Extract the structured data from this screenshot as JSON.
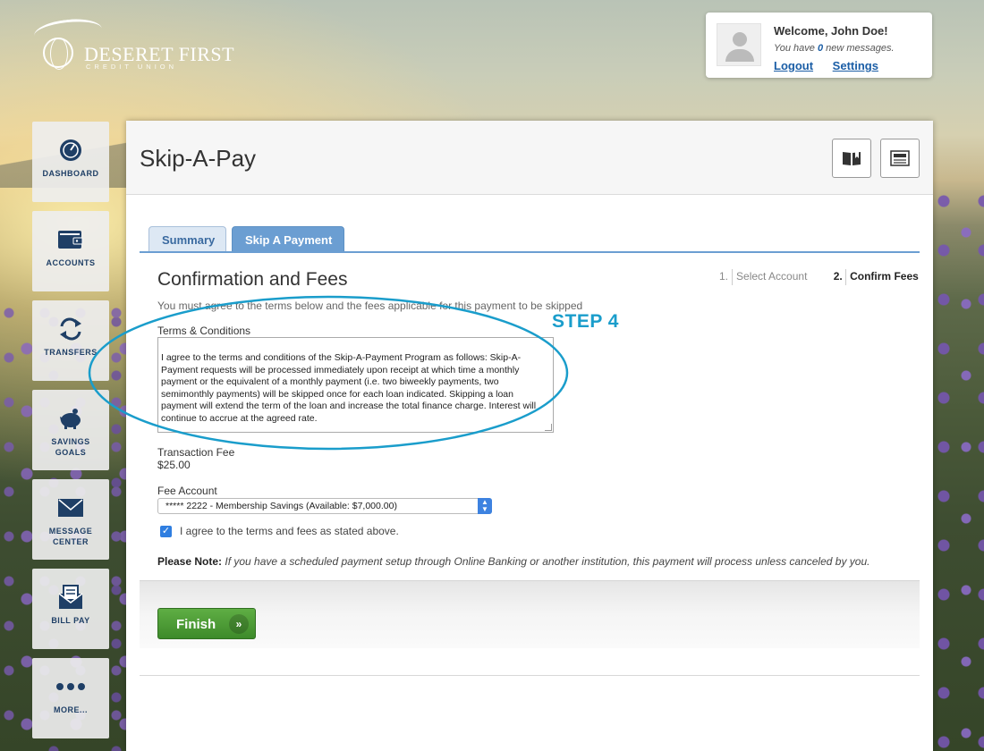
{
  "logo": {
    "name": "DESERET FIRST",
    "sub": "CREDIT UNION"
  },
  "welcome": {
    "title": "Welcome, John Doe!",
    "message_prefix": "You have",
    "message_count": "0",
    "message_suffix": "new messages.",
    "logout": "Logout",
    "settings": "Settings"
  },
  "nav": [
    {
      "label": "DASHBOARD",
      "icon": "dashboard-icon"
    },
    {
      "label": "ACCOUNTS",
      "icon": "wallet-icon"
    },
    {
      "label": "TRANSFERS",
      "icon": "transfer-icon"
    },
    {
      "label1": "SAVINGS",
      "label2": "GOALS",
      "icon": "piggy-bank-icon"
    },
    {
      "label1": "MESSAGE",
      "label2": "CENTER",
      "icon": "envelope-icon"
    },
    {
      "label": "BILL PAY",
      "icon": "bill-pay-icon"
    },
    {
      "label": "MORE...",
      "icon": "more-dots-icon"
    }
  ],
  "page": {
    "title": "Skip-A-Pay"
  },
  "tabs": {
    "summary": "Summary",
    "skip": "Skip A Payment"
  },
  "steps": {
    "step1_num": "1.",
    "step1_label": "Select Account",
    "step2_num": "2.",
    "step2_label": "Confirm Fees"
  },
  "form": {
    "section_title": "Confirmation and Fees",
    "intro": "You must agree to the terms below and the fees applicable for this payment to be skipped",
    "terms_label": "Terms & Conditions",
    "terms_text": "I agree to the terms and conditions of the Skip-A-Payment Program as follows:\nSkip-A-Payment requests will be processed immediately upon receipt at which time a monthly payment or the equivalent of a monthly payment (i.e. two biweekly payments, two semimonthly payments) will be skipped once for each loan indicated.  Skipping a loan payment will extend the term of the loan and increase the total finance charge.  Interest will continue to accrue at the agreed rate.",
    "fee_label": "Transaction Fee",
    "fee_value": "$25.00",
    "account_label": "Fee Account",
    "account_selected": "***** 2222 - Membership Savings (Available: $7,000.00)",
    "agree_label": "I agree to the terms and fees as stated above.",
    "note_bold": "Please Note:",
    "note_text": " If you have a scheduled payment setup through Online Banking or another institution, this payment will process unless canceled by you."
  },
  "finish": {
    "label": "Finish"
  },
  "annotation": {
    "step": "STEP 4",
    "color": "#1a9dcb"
  }
}
